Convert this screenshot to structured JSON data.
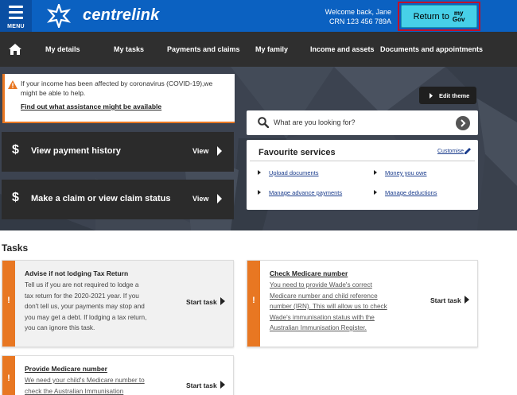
{
  "header": {
    "menu_label": "MENU",
    "logo_text": "centrelink",
    "welcome": "Welcome back, Jane",
    "crn": "CRN 123 456 789A",
    "mygov_button": {
      "prefix": "Return to",
      "my": "my",
      "gov": "Gov"
    },
    "colors": {
      "header_bg": "#0b61c1",
      "mygov_bg": "#47d0e8",
      "highlight_border": "#c1102a"
    }
  },
  "nav": {
    "home_icon": "home-icon",
    "items": [
      "My details",
      "My tasks",
      "Payments and claims",
      "My family",
      "Income and assets",
      "Documents and appointments"
    ]
  },
  "alert": {
    "icon": "warning-icon",
    "message": "If your income has been affected by coronavirus (COVID-19),we might be able to help.",
    "link": "Find out what assistance might be available"
  },
  "tiles": [
    {
      "icon": "dollar-icon",
      "label": "View payment history",
      "action": "View"
    },
    {
      "icon": "dollar-icon",
      "label": "Make a claim or view claim status",
      "action": "View"
    }
  ],
  "edit_theme": "Edit theme",
  "search": {
    "placeholder": "What are you looking for?",
    "icon": "search-icon",
    "go_icon": "arrow-right-circle-icon"
  },
  "favourites": {
    "title": "Favourite services",
    "customise": "Customise",
    "links": [
      "Upload documents",
      "Money you owe",
      "Manage advance payments",
      "Manage deductions"
    ]
  },
  "tasks": {
    "heading": "Tasks",
    "items": [
      {
        "title": "Advise if not lodging Tax Return",
        "lines": [
          "Tell us if you are not required to lodge a",
          "tax return for the 2020-2021 year. If you",
          "don't tell us, your payments may stop and",
          "you may get a debt. If lodging a tax return,",
          "you can ignore this task."
        ],
        "action": "Start task"
      },
      {
        "title": "Check Medicare number",
        "lines": [
          "You need to provide Wade's correct",
          "Medicare number and child reference",
          "number (IRN). This will allow us to check",
          "Wade's immunisation status with the",
          "Australian Immunisation Register."
        ],
        "action": "Start task"
      },
      {
        "title": "Provide Medicare number",
        "lines": [
          "We need your child's Medicare number to",
          "check the Australian Immunisation"
        ],
        "action": "Start task"
      }
    ],
    "accent": "#e87722"
  }
}
